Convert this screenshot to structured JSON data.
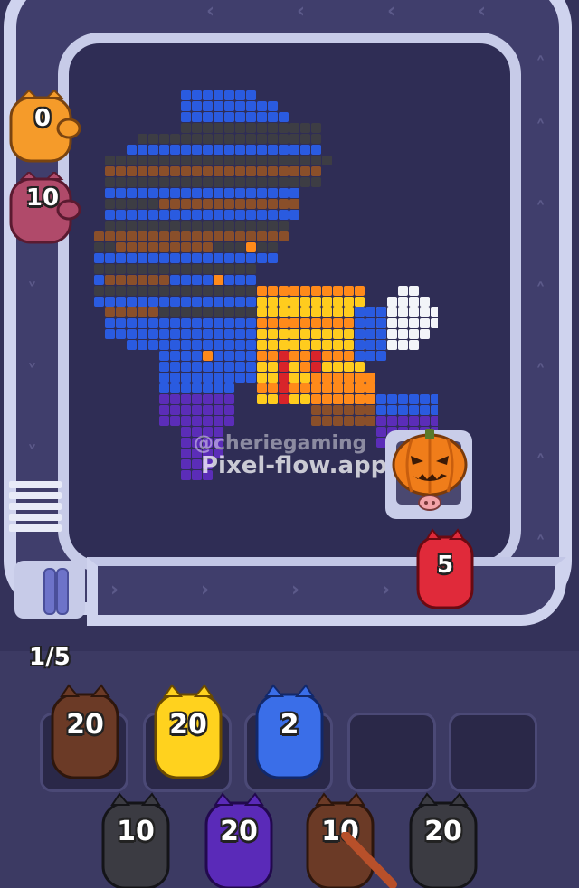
{
  "colors": {
    "blue": "#2a5be0",
    "dark": "#3d3d44",
    "brown": "#8a4f2a",
    "yellow": "#ffcc1e",
    "orange": "#ff8a1a",
    "red": "#d8242a",
    "white": "#f2f4f8",
    "purple": "#5b2db8"
  },
  "watermark": {
    "handle": "@cheriegaming",
    "site": "Pixel-flow.app"
  },
  "conveyor": {
    "pigs": [
      {
        "count": "0",
        "color": "orange"
      },
      {
        "count": "10",
        "color": "pink"
      },
      {
        "count": "5",
        "color": "red"
      }
    ]
  },
  "launcher": {
    "progress_label": "1/5"
  },
  "slots": {
    "pigs": [
      {
        "count": "20",
        "color": "brown"
      },
      {
        "count": "20",
        "color": "yellow"
      },
      {
        "count": "2",
        "color": "blue"
      }
    ],
    "empty_slots": 2
  },
  "queue": {
    "pigs": [
      {
        "count": "10",
        "color": "dark"
      },
      {
        "count": "20",
        "color": "purple"
      },
      {
        "count": "10",
        "color": "brown"
      },
      {
        "count": "20",
        "color": "dark"
      }
    ]
  },
  "icons": {
    "blocked_pig": "pumpkin-icon",
    "track_arrows": "chevron-icon"
  }
}
